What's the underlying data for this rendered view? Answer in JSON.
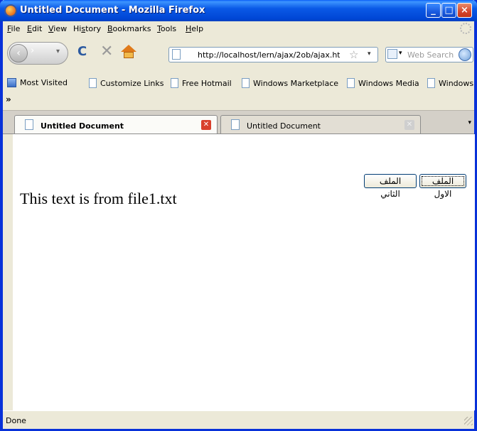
{
  "window": {
    "title": "Untitled Document - Mozilla Firefox",
    "min": "_",
    "max": "□",
    "close": "×"
  },
  "menu": [
    {
      "ul": "F",
      "rest": "ile"
    },
    {
      "ul": "E",
      "rest": "dit"
    },
    {
      "ul": "V",
      "rest": "iew"
    },
    {
      "ul": "",
      "pre": "Hi",
      "ulmid": "s",
      "rest": "tory"
    },
    {
      "ul": "B",
      "rest": "ookmarks"
    },
    {
      "ul": "T",
      "rest": "ools"
    },
    {
      "ul": "H",
      "rest": "elp"
    }
  ],
  "menu_labels": [
    "File",
    "Edit",
    "View",
    "History",
    "Bookmarks",
    "Tools",
    "Help"
  ],
  "nav": {
    "back": "‹",
    "forward": "›",
    "history_dropdown": "▾",
    "reload": "C",
    "stop": "✕",
    "url": "http://localhost/lern/ajax/2ob/ajax.ht",
    "star": "☆",
    "url_dropdown": "▾",
    "search_engine_dropdown": "▾",
    "search_placeholder": "Web Search"
  },
  "bookmarks": [
    {
      "label": "Most Visited",
      "icon": "most-visited-icon"
    },
    {
      "label": "Customize Links",
      "icon": "page-icon"
    },
    {
      "label": "Free Hotmail",
      "icon": "page-icon"
    },
    {
      "label": "Windows Marketplace",
      "icon": "page-icon"
    },
    {
      "label": "Windows Media",
      "icon": "page-icon"
    },
    {
      "label": "Windows",
      "icon": "page-icon"
    }
  ],
  "bookmarks_overflow": "»",
  "tabs": [
    {
      "label": "Untitled Document",
      "active": true,
      "close": "✕"
    },
    {
      "label": "Untitled Document",
      "active": false,
      "close": "✕"
    }
  ],
  "tab_list_arrow": "▾",
  "page": {
    "button_first": "الملف الاول",
    "button_second": "الملف الثاني",
    "result_text": "This text is from file1.txt"
  },
  "status": {
    "text": "Done"
  },
  "colors": {
    "titlebar": "#0046d5",
    "chrome": "#ece9d8",
    "close_tab": "#d9402c"
  }
}
